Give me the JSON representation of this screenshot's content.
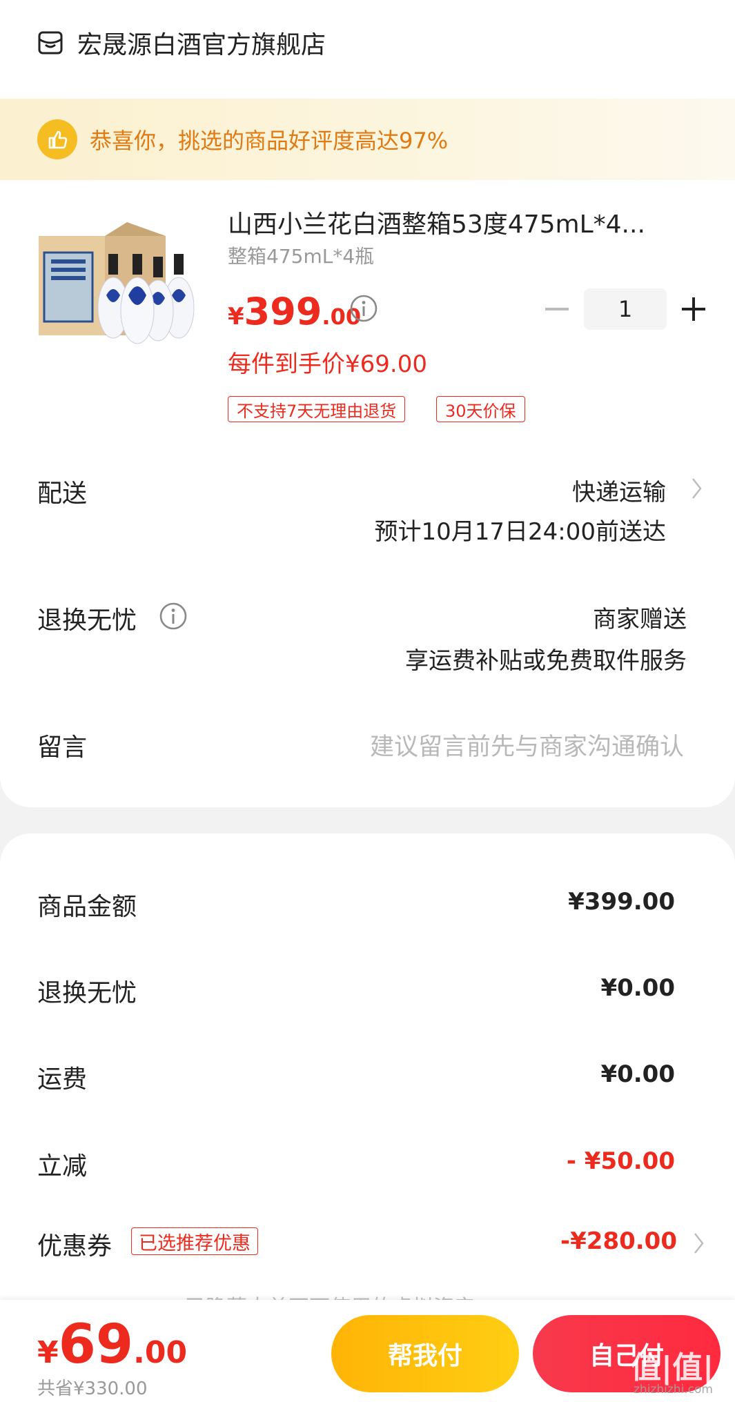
{
  "store": {
    "name": "宏晟源白酒官方旗舰店",
    "icon": "store-icon"
  },
  "banner": {
    "text": "恭喜你，挑选的商品好评度高达97%",
    "icon": "thumbs-up-icon",
    "accent": "#e07a12"
  },
  "product": {
    "title": "山西小兰花白酒整箱53度475mL*4...",
    "spec": "整箱475mL*4瓶",
    "price_symbol": "¥",
    "price_int": "399",
    "price_dec": ".00",
    "per_price": "每件到手价¥69.00",
    "quantity": "1",
    "tags": [
      "不支持7天无理由退货",
      "30天价保"
    ]
  },
  "delivery": {
    "label": "配送",
    "method": "快递运输",
    "eta": "预计10月17日24:00前送达"
  },
  "return_service": {
    "label": "退换无忧",
    "value": "商家赠送",
    "desc": "享运费补贴或免费取件服务"
  },
  "message": {
    "label": "留言",
    "placeholder": "建议留言前先与商家沟通确认"
  },
  "costs": {
    "goods_label": "商品金额",
    "goods_value": "¥399.00",
    "return_label": "退换无忧",
    "return_value": "¥0.00",
    "shipping_label": "运费",
    "shipping_value": "¥0.00",
    "discount_label": "立减",
    "discount_value": "- ¥50.00",
    "coupon_label": "优惠券",
    "coupon_tag": "已选推荐优惠",
    "coupon_value": "-¥280.00",
    "faded_note": "已隐藏本单不可使用的虚拟资产"
  },
  "footer": {
    "symbol": "¥",
    "total_int": "69",
    "total_dec": ".00",
    "saved": "共省¥330.00",
    "help_pay": "帮我付",
    "self_pay": "自己付"
  },
  "watermark": {
    "main": "值|值|值",
    "sub": "zhizhizhi.com"
  },
  "colors": {
    "price_red": "#ec2a1e",
    "help_yellow": "#ffb406",
    "self_red": "#f8394c"
  }
}
